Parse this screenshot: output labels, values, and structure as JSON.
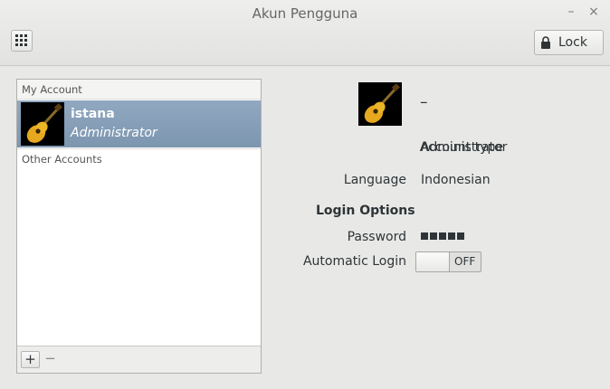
{
  "window": {
    "title": "Akun Pengguna",
    "minimize_glyph": "–",
    "close_glyph": "×"
  },
  "toolbar": {
    "apps_icon": "grid-icon",
    "lock_label": "Lock",
    "lock_icon": "padlock-icon"
  },
  "accounts": {
    "my_account_header": "My Account",
    "other_accounts_header": "Other Accounts",
    "items": [
      {
        "name": "istana",
        "role": "Administrator",
        "avatar": "guitar-icon",
        "selected": true
      }
    ],
    "add_glyph": "+",
    "remove_glyph": "−"
  },
  "details": {
    "full_name": "–",
    "account_type_label": "Account type",
    "account_type_value": "Administrator",
    "language_label": "Language",
    "language_value": "Indonesian",
    "login_options_heading": "Login Options",
    "password_label": "Password",
    "password_dot_count": 5,
    "automatic_login_label": "Automatic Login",
    "automatic_login_state": "OFF"
  },
  "colors": {
    "selection": "#7d96af",
    "background": "#e8e8e7"
  }
}
